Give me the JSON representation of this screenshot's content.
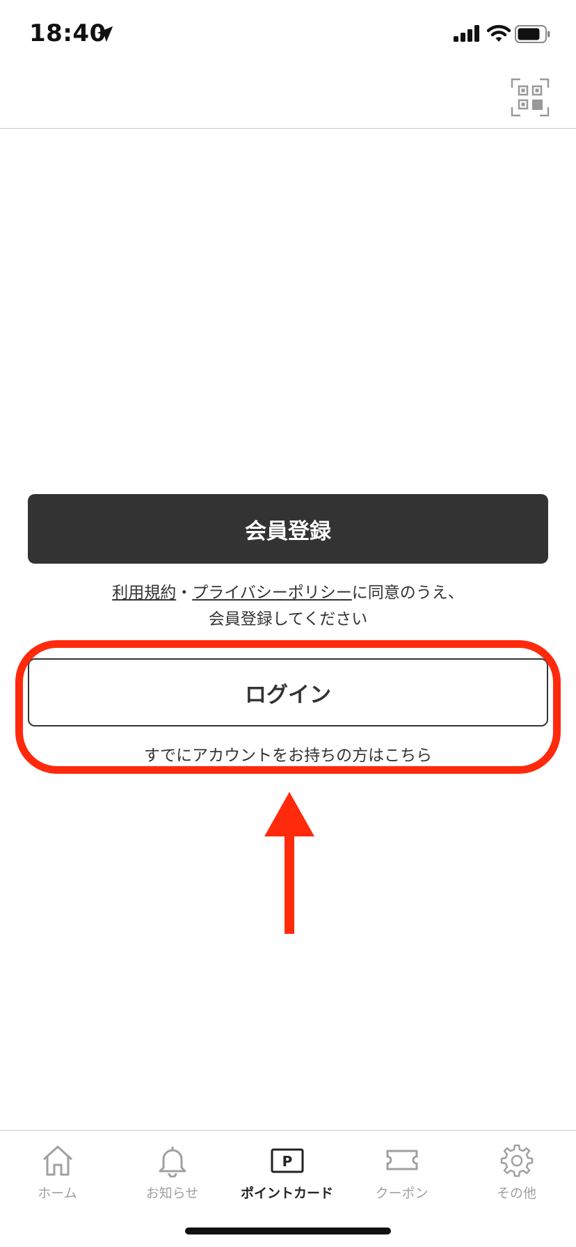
{
  "status_bar": {
    "time": "18:40"
  },
  "register": {
    "button_label": "会員登録",
    "terms_link": "利用規約",
    "separator": "・",
    "privacy_link": "プライバシーポリシー",
    "agree_suffix": "に同意のうえ、",
    "agree_line2": "会員登録してください"
  },
  "login": {
    "button_label": "ログイン",
    "note": "すでにアカウントをお持ちの方はこちら"
  },
  "tabs": [
    {
      "label": "ホーム",
      "icon": "home-icon",
      "active": false
    },
    {
      "label": "お知らせ",
      "icon": "bell-icon",
      "active": false
    },
    {
      "label": "ポイントカード",
      "icon": "point-card-icon",
      "active": true
    },
    {
      "label": "クーポン",
      "icon": "coupon-icon",
      "active": false
    },
    {
      "label": "その他",
      "icon": "gear-icon",
      "active": false
    }
  ],
  "colors": {
    "primary_button": "#333333",
    "annotation_red": "#ff2a0c",
    "inactive_tab": "#a0a0a0"
  }
}
